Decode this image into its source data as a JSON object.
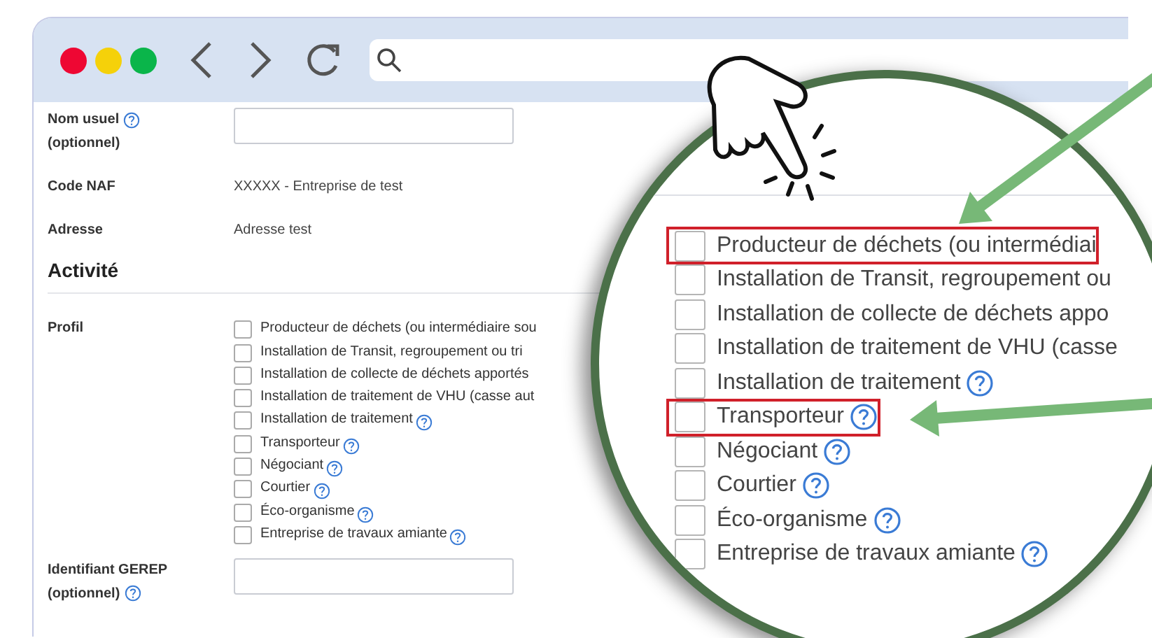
{
  "form": {
    "rows": [
      {
        "kind": "input",
        "label_lines": [
          {
            "text": "Nom usuel",
            "help": true
          },
          {
            "text": "(optionnel)",
            "help": false
          }
        ]
      },
      {
        "kind": "text",
        "label_lines": [
          {
            "text": "Code NAF",
            "help": false
          }
        ],
        "value": "XXXXX - Entreprise de test"
      },
      {
        "kind": "text",
        "label_lines": [
          {
            "text": "Adresse",
            "help": false
          }
        ],
        "value": "Adresse test"
      }
    ]
  },
  "section": {
    "title": "Activité"
  },
  "profile": {
    "label": "Profil",
    "options": [
      {
        "label": "Producteur de déchets (ou intermédiaire sou",
        "checked": false,
        "help": false
      },
      {
        "label": "Installation de Transit, regroupement ou tri",
        "checked": false,
        "help": false
      },
      {
        "label": "Installation de collecte de déchets apportés",
        "checked": false,
        "help": false
      },
      {
        "label": "Installation de traitement de VHU (casse aut",
        "checked": false,
        "help": false
      },
      {
        "label": "Installation de traitement",
        "checked": false,
        "help": true
      },
      {
        "label": "Transporteur",
        "checked": false,
        "help": true
      },
      {
        "label": "Négociant",
        "checked": false,
        "help": true
      },
      {
        "label": "Courtier",
        "checked": false,
        "help": true
      },
      {
        "label": "Éco-organisme",
        "checked": false,
        "help": true
      },
      {
        "label": "Entreprise de travaux amiante",
        "checked": false,
        "help": true
      }
    ]
  },
  "form_bottom": {
    "rows": [
      {
        "kind": "input",
        "label_lines": [
          {
            "text": "Identifiant GEREP",
            "help": false
          },
          {
            "text": "(optionnel)",
            "help": true
          }
        ]
      }
    ]
  },
  "magnifier": {
    "options": [
      {
        "label": "Producteur de déchets (ou intermédiai",
        "checked": false,
        "help": false,
        "highlighted": true
      },
      {
        "label": "Installation de Transit, regroupement ou",
        "checked": false,
        "help": false,
        "highlighted": false
      },
      {
        "label": "Installation de collecte de déchets appo",
        "checked": false,
        "help": false,
        "highlighted": false
      },
      {
        "label": "Installation de traitement de VHU (casse",
        "checked": false,
        "help": false,
        "highlighted": false
      },
      {
        "label": "Installation de traitement",
        "checked": false,
        "help": true,
        "highlighted": false
      },
      {
        "label": "Transporteur",
        "checked": false,
        "help": true,
        "highlighted": true
      },
      {
        "label": "Négociant",
        "checked": false,
        "help": true,
        "highlighted": false
      },
      {
        "label": "Courtier",
        "checked": false,
        "help": true,
        "highlighted": false
      },
      {
        "label": "Éco-organisme",
        "checked": false,
        "help": true,
        "highlighted": false
      },
      {
        "label": "Entreprise de travaux amiante",
        "checked": false,
        "help": true,
        "highlighted": false
      }
    ]
  }
}
